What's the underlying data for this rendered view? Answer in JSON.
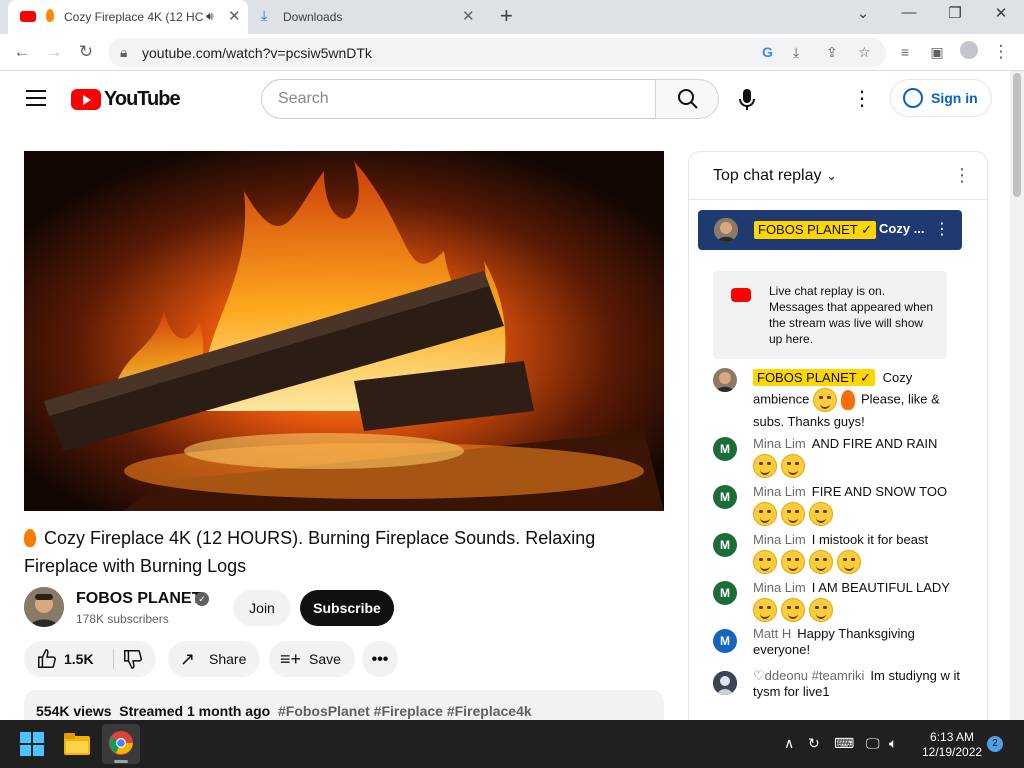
{
  "browser": {
    "tabs": [
      {
        "label": "Cozy Fireplace 4K (12 HC",
        "active": true
      },
      {
        "label": "Downloads",
        "active": false
      }
    ],
    "new_tab": "+",
    "url": "youtube.com/watch?v=pcsiw5wnDTk"
  },
  "header": {
    "logo_text": "YouTube",
    "search_placeholder": "Search",
    "sign_in": "Sign in"
  },
  "video": {
    "title": "Cozy Fireplace 4K (12 HOURS). Burning Fireplace Sounds. Relaxing Fireplace with Burning Logs",
    "channel": "FOBOS PLANET",
    "subscribers": "178K subscribers",
    "join": "Join",
    "subscribe": "Subscribe",
    "likes": "1.5K",
    "share": "Share",
    "save": "Save",
    "views": "554K views",
    "streamed": "Streamed 1 month ago",
    "tags": "#FobosPlanet #Fireplace #Fireplace4k"
  },
  "chat": {
    "mode": "Top chat replay",
    "pinned_author": "FOBOS PLANET",
    "pinned_text": "Cozy ...",
    "notice": "Live chat replay is on. Messages that appeared when the stream was live will show up here.",
    "messages": [
      {
        "author": "FOBOS PLANET",
        "text_a": "Cozy",
        "text_b": "ambience",
        "text_c": "Please, like & subs. Thanks guys!"
      },
      {
        "author": "Mina Lim",
        "text": "AND FIRE AND RAIN",
        "initial": "M"
      },
      {
        "author": "Mina Lim",
        "text": "FIRE AND SNOW TOO",
        "initial": "M"
      },
      {
        "author": "Mina Lim",
        "text": "I mistook it for beast",
        "initial": "M"
      },
      {
        "author": "Mina Lim",
        "text": "I AM BEAUTIFUL LADY",
        "initial": "M"
      },
      {
        "author": "Matt H",
        "text": "Happy Thanksgiving everyone!",
        "initial": "M"
      },
      {
        "author": "♡ddeonu #teamriki",
        "text": "Im studiyng w it tysm for live1"
      }
    ]
  },
  "taskbar": {
    "time": "6:13 AM",
    "date": "12/19/2022",
    "notifications": "2"
  },
  "colors": {
    "brand_red": "#ff0000",
    "link_blue": "#065fd4",
    "pinned_bg": "#1f3a70",
    "owner_badge": "#ffd600",
    "avatar_green": "#1e6b3a",
    "avatar_blue": "#1565c0"
  }
}
